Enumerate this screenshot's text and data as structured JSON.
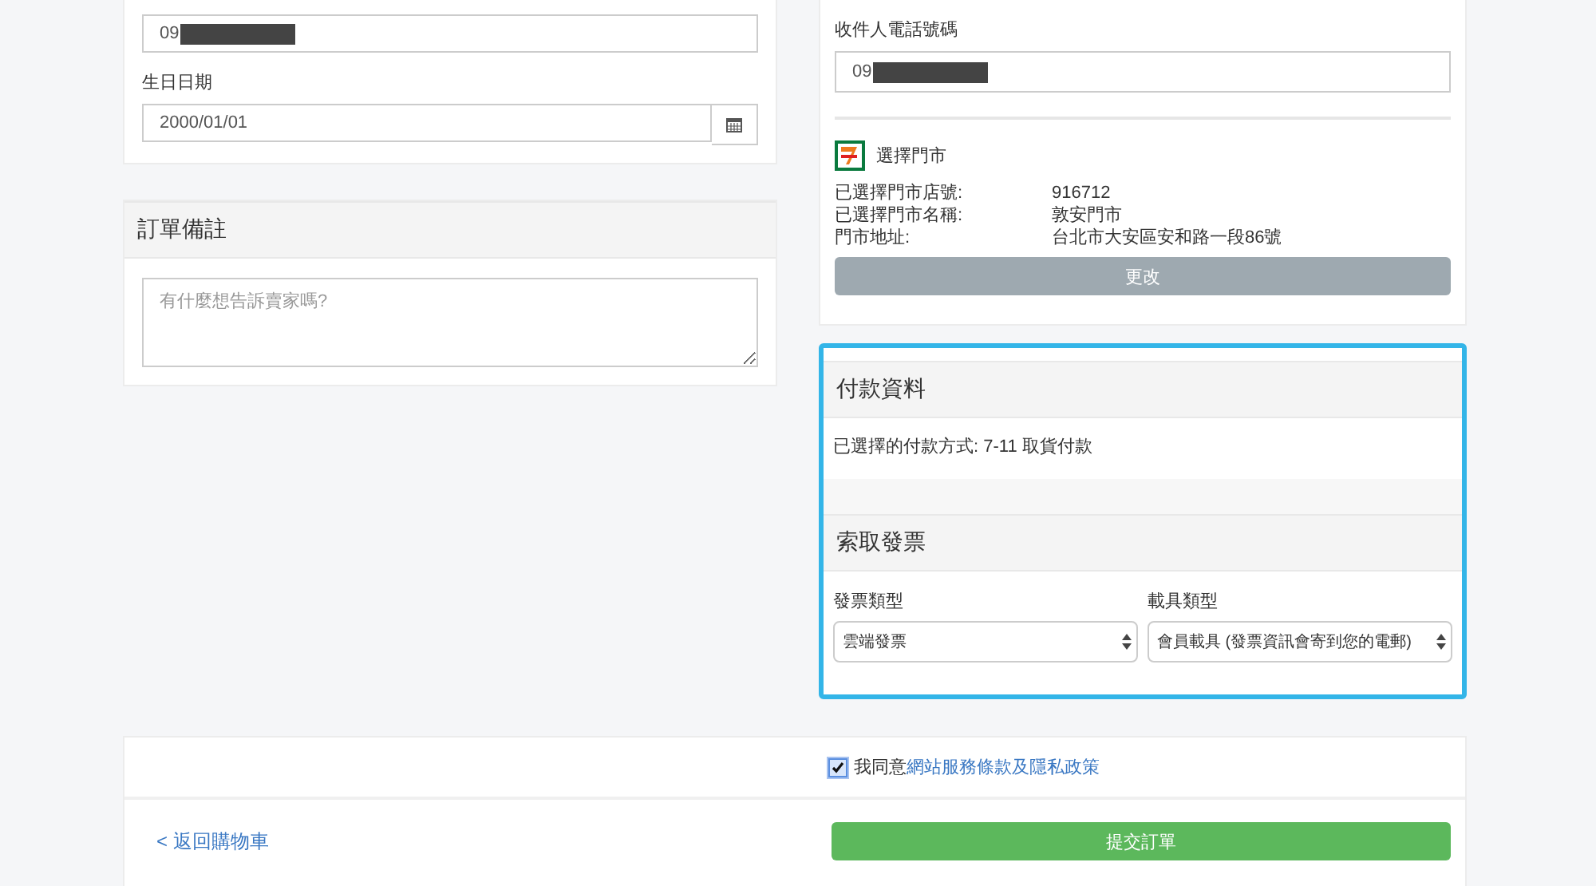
{
  "contact": {
    "phone_value": "09",
    "birthday": {
      "label": "生日日期",
      "value": "2000/01/01"
    }
  },
  "order_note": {
    "title": "訂單備註",
    "placeholder": "有什麼想告訴賣家嗎?"
  },
  "recipient": {
    "phone_label": "收件人電話號碼",
    "phone_value": "09"
  },
  "store": {
    "title": "選擇門市",
    "rows": [
      {
        "label": "已選擇門市店號:",
        "value": "916712"
      },
      {
        "label": "已選擇門市名稱:",
        "value": "敦安門市"
      },
      {
        "label": "門市地址:",
        "value": "台北市大安區安和路一段86號"
      }
    ],
    "change_button": "更改"
  },
  "payment": {
    "title": "付款資料",
    "method": "已選擇的付款方式: 7-11 取貨付款",
    "highlighted": true
  },
  "invoice": {
    "title": "索取發票",
    "fields": [
      {
        "label": "發票類型",
        "value": "雲端發票"
      },
      {
        "label": "載具類型",
        "value": "會員載具 (發票資訊會寄到您的電郵)"
      }
    ]
  },
  "agreement": {
    "checked": true,
    "text": "我同意",
    "link": "網站服務條款及隱私政策"
  },
  "back_link": "< 返回購物車",
  "submit_button": "提交訂單"
}
